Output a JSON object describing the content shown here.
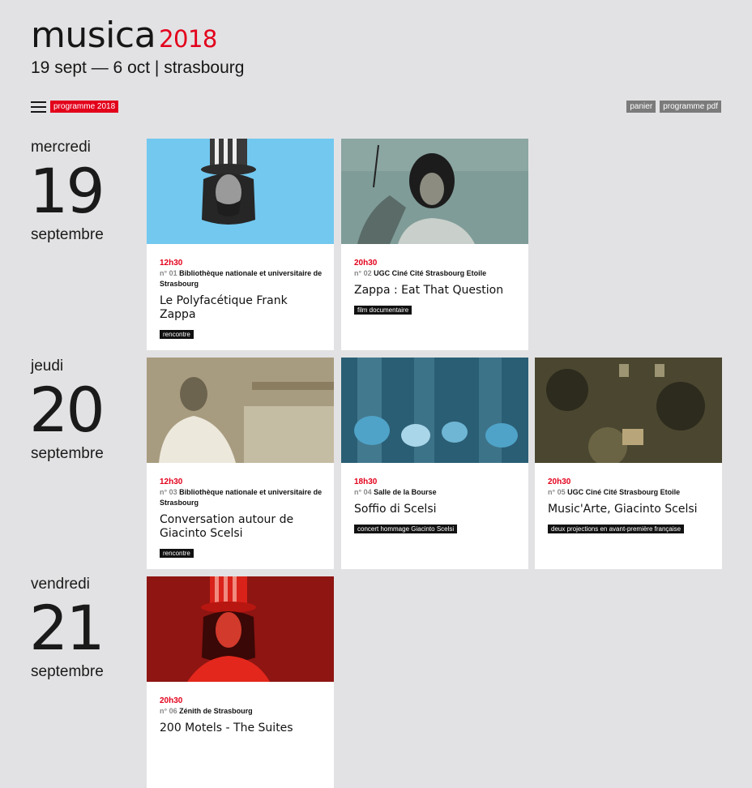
{
  "header": {
    "logo": "musica",
    "year": "2018",
    "dates": "19 sept — 6 oct | strasbourg"
  },
  "toolbar": {
    "programme_label": "programme 2018",
    "panier_label": "panier",
    "pdf_label": "programme pdf"
  },
  "days": [
    {
      "weekday": "mercredi",
      "number": "19",
      "month": "septembre"
    },
    {
      "weekday": "jeudi",
      "number": "20",
      "month": "septembre"
    },
    {
      "weekday": "vendredi",
      "number": "21",
      "month": "septembre"
    }
  ],
  "events": [
    {
      "time": "12h30",
      "number": "n° 01",
      "venue": "Bibliothèque nationale et universitaire de Strasbourg",
      "title": "Le Polyfacétique Frank Zappa",
      "tag": "rencontre",
      "image_bg": "#72c8ef"
    },
    {
      "time": "20h30",
      "number": "n° 02",
      "venue": "UGC Ciné Cité Strasbourg Etoile",
      "title": "Zappa : Eat That Question",
      "tag": "film documentaire",
      "image_bg": "#7f9c98"
    },
    {
      "time": "12h30",
      "number": "n° 03",
      "venue": "Bibliothèque nationale et universitaire de Strasbourg",
      "title": "Conversation autour de Giacinto Scelsi",
      "tag": "rencontre",
      "image_bg": "#a89c80"
    },
    {
      "time": "18h30",
      "number": "n° 04",
      "venue": "Salle de la Bourse",
      "title": "Soffio di Scelsi",
      "tag": "concert hommage Giacinto Scelsi",
      "image_bg": "#2a5e74"
    },
    {
      "time": "20h30",
      "number": "n° 05",
      "venue": "UGC Ciné Cité Strasbourg Etoile",
      "title": "Music'Arte, Giacinto Scelsi",
      "tag": "deux projections en avant-première française",
      "image_bg": "#4a4630"
    },
    {
      "time": "20h30",
      "number": "n° 06",
      "venue": "Zénith de Strasbourg",
      "title": "200 Motels - The Suites",
      "tag": "",
      "image_bg": "#8e1512"
    }
  ],
  "colors": {
    "accent": "#e3001b",
    "background": "#e2e2e4",
    "tag": "#111111"
  },
  "icons": [
    "menu-icon"
  ]
}
